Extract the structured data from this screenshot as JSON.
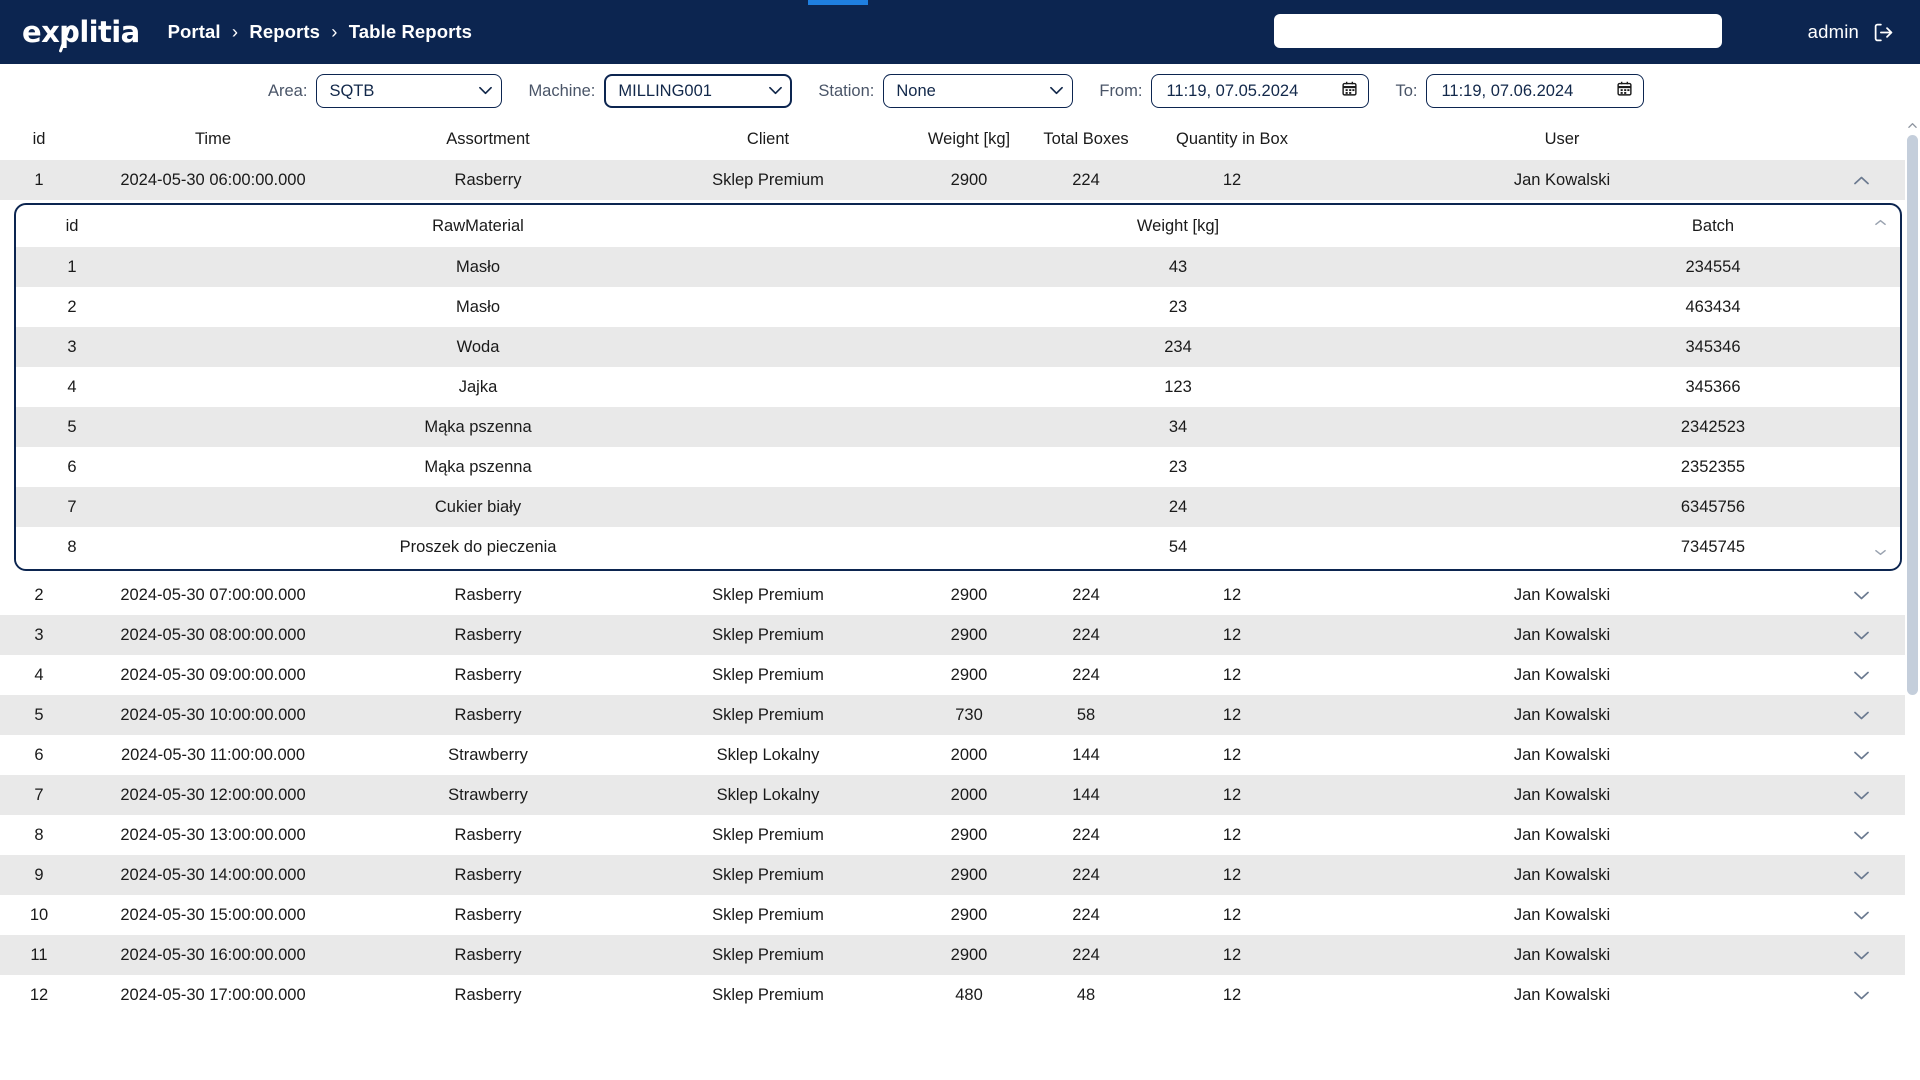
{
  "header": {
    "logo_text": "explitia",
    "breadcrumb": [
      "Portal",
      "Reports",
      "Table Reports"
    ],
    "breadcrumb_separator": "›",
    "search_value": "",
    "search_placeholder": "",
    "user_name": "admin",
    "logout_icon": "logout-icon",
    "background_color": "#0c2550",
    "loading_bar_color": "#1f7fe0"
  },
  "filters": {
    "area": {
      "label": "Area:",
      "value": "SQTB",
      "options": [
        "SQTB"
      ]
    },
    "machine": {
      "label": "Machine:",
      "value": "MILLING001",
      "options": [
        "MILLING001"
      ],
      "focused": true
    },
    "station": {
      "label": "Station:",
      "value": "None",
      "options": [
        "None"
      ]
    },
    "from": {
      "label": "From:",
      "value": "11:19, 07.05.2024",
      "icon": "calendar-icon"
    },
    "to": {
      "label": "To:",
      "value": "11:19, 07.06.2024",
      "icon": "calendar-icon"
    }
  },
  "table": {
    "columns": [
      "id",
      "Time",
      "Assortment",
      "Client",
      "Weight [kg]",
      "Total Boxes",
      "Quantity in Box",
      "User"
    ],
    "rows": [
      {
        "id": "1",
        "time": "2024-05-30 06:00:00.000",
        "assortment": "Rasberry",
        "client": "Sklep Premium",
        "weight": "2900",
        "boxes": "224",
        "qty": "12",
        "user": "Jan Kowalski",
        "expanded": true
      },
      {
        "id": "2",
        "time": "2024-05-30 07:00:00.000",
        "assortment": "Rasberry",
        "client": "Sklep Premium",
        "weight": "2900",
        "boxes": "224",
        "qty": "12",
        "user": "Jan Kowalski",
        "expanded": false
      },
      {
        "id": "3",
        "time": "2024-05-30 08:00:00.000",
        "assortment": "Rasberry",
        "client": "Sklep Premium",
        "weight": "2900",
        "boxes": "224",
        "qty": "12",
        "user": "Jan Kowalski",
        "expanded": false
      },
      {
        "id": "4",
        "time": "2024-05-30 09:00:00.000",
        "assortment": "Rasberry",
        "client": "Sklep Premium",
        "weight": "2900",
        "boxes": "224",
        "qty": "12",
        "user": "Jan Kowalski",
        "expanded": false
      },
      {
        "id": "5",
        "time": "2024-05-30 10:00:00.000",
        "assortment": "Rasberry",
        "client": "Sklep Premium",
        "weight": "730",
        "boxes": "58",
        "qty": "12",
        "user": "Jan Kowalski",
        "expanded": false
      },
      {
        "id": "6",
        "time": "2024-05-30 11:00:00.000",
        "assortment": "Strawberry",
        "client": "Sklep Lokalny",
        "weight": "2000",
        "boxes": "144",
        "qty": "12",
        "user": "Jan Kowalski",
        "expanded": false
      },
      {
        "id": "7",
        "time": "2024-05-30 12:00:00.000",
        "assortment": "Strawberry",
        "client": "Sklep Lokalny",
        "weight": "2000",
        "boxes": "144",
        "qty": "12",
        "user": "Jan Kowalski",
        "expanded": false
      },
      {
        "id": "8",
        "time": "2024-05-30 13:00:00.000",
        "assortment": "Rasberry",
        "client": "Sklep Premium",
        "weight": "2900",
        "boxes": "224",
        "qty": "12",
        "user": "Jan Kowalski",
        "expanded": false
      },
      {
        "id": "9",
        "time": "2024-05-30 14:00:00.000",
        "assortment": "Rasberry",
        "client": "Sklep Premium",
        "weight": "2900",
        "boxes": "224",
        "qty": "12",
        "user": "Jan Kowalski",
        "expanded": false
      },
      {
        "id": "10",
        "time": "2024-05-30 15:00:00.000",
        "assortment": "Rasberry",
        "client": "Sklep Premium",
        "weight": "2900",
        "boxes": "224",
        "qty": "12",
        "user": "Jan Kowalski",
        "expanded": false
      },
      {
        "id": "11",
        "time": "2024-05-30 16:00:00.000",
        "assortment": "Rasberry",
        "client": "Sklep Premium",
        "weight": "2900",
        "boxes": "224",
        "qty": "12",
        "user": "Jan Kowalski",
        "expanded": false
      },
      {
        "id": "12",
        "time": "2024-05-30 17:00:00.000",
        "assortment": "Rasberry",
        "client": "Sklep Premium",
        "weight": "480",
        "boxes": "48",
        "qty": "12",
        "user": "Jan Kowalski",
        "expanded": false
      }
    ]
  },
  "subtable": {
    "columns": [
      "id",
      "RawMaterial",
      "Weight [kg]",
      "Batch"
    ],
    "rows": [
      {
        "id": "1",
        "material": "Masło",
        "weight": "43",
        "batch": "234554"
      },
      {
        "id": "2",
        "material": "Masło",
        "weight": "23",
        "batch": "463434"
      },
      {
        "id": "3",
        "material": "Woda",
        "weight": "234",
        "batch": "345346"
      },
      {
        "id": "4",
        "material": "Jajka",
        "weight": "123",
        "batch": "345366"
      },
      {
        "id": "5",
        "material": "Mąka pszenna",
        "weight": "34",
        "batch": "2342523"
      },
      {
        "id": "6",
        "material": "Mąka pszenna",
        "weight": "23",
        "batch": "2352355"
      },
      {
        "id": "7",
        "material": "Cukier biały",
        "weight": "24",
        "batch": "6345756"
      },
      {
        "id": "8",
        "material": "Proszek do pieczenia",
        "weight": "54",
        "batch": "7345745"
      }
    ]
  },
  "icons": {
    "chevron_down": "chevron-down-icon",
    "chevron_up": "chevron-up-icon",
    "scroll_up": "scroll-up-arrow-icon",
    "scroll_down": "scroll-down-arrow-icon"
  }
}
